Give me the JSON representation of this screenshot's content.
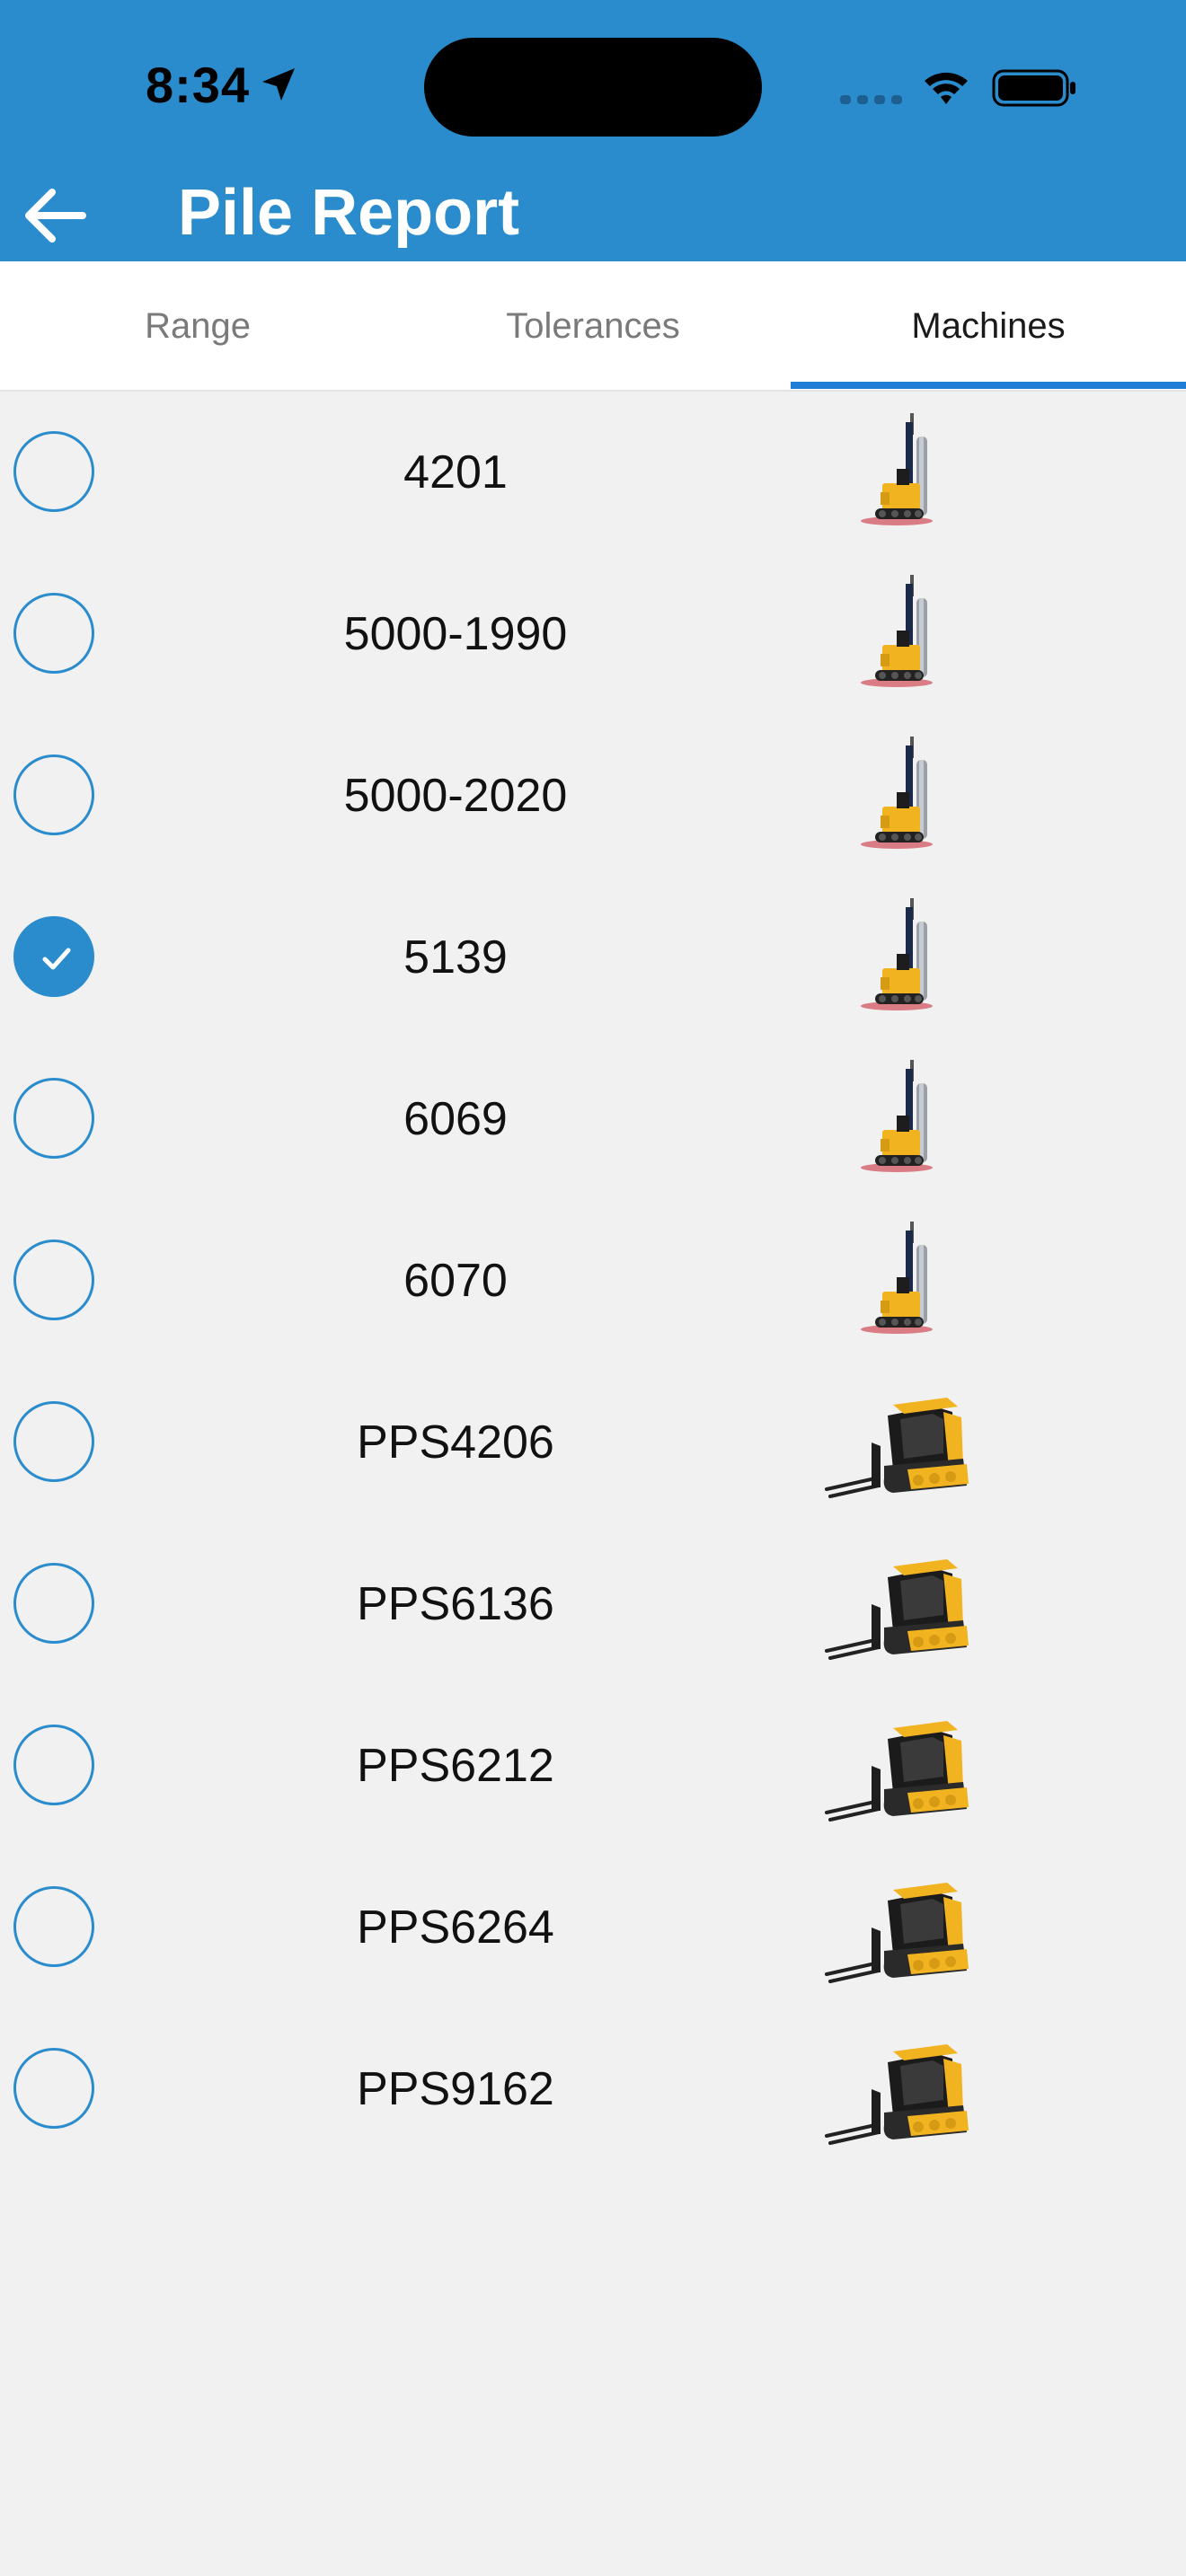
{
  "status_bar": {
    "time": "8:34"
  },
  "header": {
    "title": "Pile Report"
  },
  "tabs": [
    {
      "label": "Range",
      "active": false
    },
    {
      "label": "Tolerances",
      "active": false
    },
    {
      "label": "Machines",
      "active": true
    }
  ],
  "colors": {
    "header_bg": "#2a8ccd",
    "accent": "#1f7fd6",
    "list_bg": "#f1f1f1",
    "machine_yellow": "#f2b321"
  },
  "machines": [
    {
      "id": "4201",
      "selected": false,
      "icon": "pile-driver-icon"
    },
    {
      "id": "5000-1990",
      "selected": false,
      "icon": "pile-driver-icon"
    },
    {
      "id": "5000-2020",
      "selected": false,
      "icon": "pile-driver-icon"
    },
    {
      "id": "5139",
      "selected": true,
      "icon": "pile-driver-icon"
    },
    {
      "id": "6069",
      "selected": false,
      "icon": "pile-driver-icon"
    },
    {
      "id": "6070",
      "selected": false,
      "icon": "pile-driver-icon"
    },
    {
      "id": "PPS4206",
      "selected": false,
      "icon": "skid-steer-icon"
    },
    {
      "id": "PPS6136",
      "selected": false,
      "icon": "skid-steer-icon"
    },
    {
      "id": "PPS6212",
      "selected": false,
      "icon": "skid-steer-icon"
    },
    {
      "id": "PPS6264",
      "selected": false,
      "icon": "skid-steer-icon"
    },
    {
      "id": "PPS9162",
      "selected": false,
      "icon": "skid-steer-icon"
    }
  ]
}
